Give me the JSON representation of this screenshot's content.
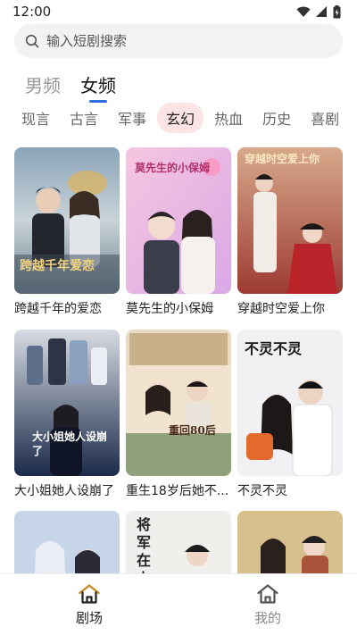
{
  "status": {
    "time": "12:00"
  },
  "search": {
    "placeholder": "输入短剧搜索"
  },
  "gender_tabs": [
    {
      "label": "男频",
      "active": false
    },
    {
      "label": "女频",
      "active": true
    }
  ],
  "genres": [
    "现言",
    "古言",
    "军事",
    "玄幻",
    "热血",
    "历史",
    "喜剧"
  ],
  "active_genre": "玄幻",
  "dramas": [
    {
      "title": "跨越千年的爱恋",
      "poster_text": "跨越千年爱恋"
    },
    {
      "title": "莫先生的小保姆",
      "poster_text": "莫先生的小保姆"
    },
    {
      "title": "穿越时空爱上你",
      "poster_text": "穿越时空爱上你"
    },
    {
      "title": "大小姐她人设崩了",
      "poster_text": "大小姐她人设崩了"
    },
    {
      "title": "重生18岁后她不...",
      "poster_text": "重回80后"
    },
    {
      "title": "不灵不灵",
      "poster_text": "不灵不灵"
    },
    {
      "title": "",
      "poster_text": ""
    },
    {
      "title": "",
      "poster_text": "将军在上"
    },
    {
      "title": "",
      "poster_text": ""
    }
  ],
  "bottom_nav": [
    {
      "label": "剧场",
      "icon": "home-icon",
      "active": true
    },
    {
      "label": "我的",
      "icon": "home-icon",
      "active": false
    }
  ],
  "colors": {
    "accent": "#2f6fe0",
    "genre_active_bg": "#fbe3e6",
    "nav_active": "#c8892a"
  }
}
